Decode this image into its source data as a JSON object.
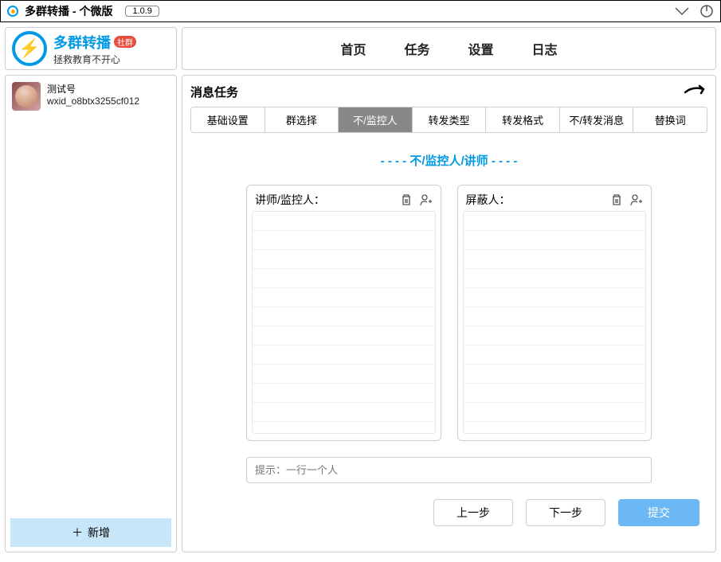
{
  "titlebar": {
    "title": "多群转播 - 个微版",
    "version": "1.0.9"
  },
  "logo": {
    "title": "多群转播",
    "badge": "社群",
    "subtitle": "拯救教育不开心"
  },
  "nav": {
    "items": {
      "home": "首页",
      "tasks": "任务",
      "settings": "设置",
      "logs": "日志"
    }
  },
  "sidebar": {
    "account": {
      "name": "测试号",
      "id": "wxid_o8btx3255cf012"
    },
    "add_label": "新增"
  },
  "panel": {
    "title": "消息任务",
    "heading": "- - - - 不/监控人/讲师 - - - -",
    "tabs": {
      "basic": "基础设置",
      "groups": "群选择",
      "monitor": "不/监控人",
      "fwd_type": "转发类型",
      "fwd_format": "转发格式",
      "fwd_msg": "不/转发消息",
      "replace": "替换词"
    },
    "list1_label": "讲师/监控人：",
    "list2_label": "屏蔽人：",
    "hint": "提示：一行一个人",
    "prev": "上一步",
    "next": "下一步",
    "submit": "提交"
  }
}
